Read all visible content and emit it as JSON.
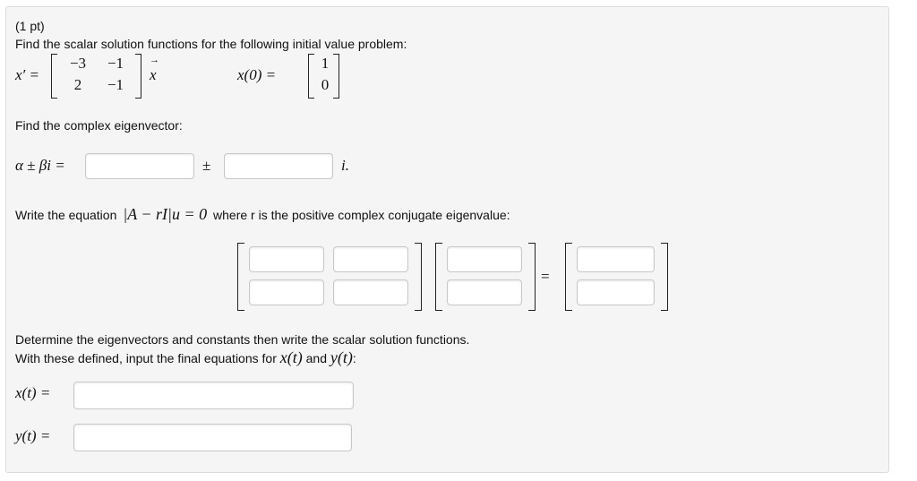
{
  "problem": {
    "points": "(1 pt)",
    "instruction": "Find the scalar solution functions for the following initial value problem:"
  },
  "system": {
    "lhs": "x′ =",
    "matrix": [
      [
        "−3",
        "−1"
      ],
      [
        "2",
        "−1"
      ]
    ],
    "rhs_var": "x",
    "ic_lhs": "x(0) =",
    "ic_vector": [
      "1",
      "0"
    ]
  },
  "eigenvector_section": {
    "prompt": "Find the complex eigenvector:",
    "label": "α ± βi =",
    "pm": "±",
    "i_suffix": "i.",
    "alpha_value": "",
    "beta_value": ""
  },
  "equation_section": {
    "prompt_before": "Write the equation",
    "equation": "|A − rI|u = 0",
    "prompt_after": "where r is the positive complex conjugate eigenvalue:",
    "equals": "="
  },
  "final_section": {
    "line1": "Determine the eigenvectors and constants then write the scalar solution functions.",
    "line2_before": "With these defined, input the final equations for",
    "line2_x": "x(t)",
    "line2_and": "and",
    "line2_y": "y(t)",
    "line2_after": ":",
    "x_label": "x(t) =",
    "y_label": "y(t) =",
    "x_value": "",
    "y_value": ""
  }
}
